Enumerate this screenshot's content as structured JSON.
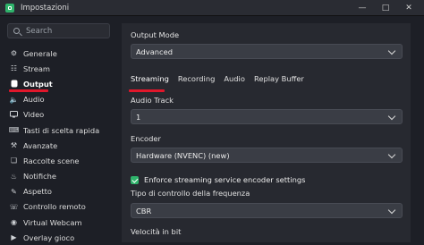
{
  "window": {
    "title": "Impostazioni"
  },
  "sidebar": {
    "search_placeholder": "Search",
    "items": [
      {
        "label": "Generale",
        "icon": "gear-icon"
      },
      {
        "label": "Stream",
        "icon": "globe-icon"
      },
      {
        "label": "Output",
        "icon": "output-icon",
        "active": true
      },
      {
        "label": "Audio",
        "icon": "speaker-icon"
      },
      {
        "label": "Video",
        "icon": "monitor-icon"
      },
      {
        "label": "Tasti di scelta rapida",
        "icon": "keyboard-icon"
      },
      {
        "label": "Avanzate",
        "icon": "wrench-icon"
      },
      {
        "label": "Raccolte scene",
        "icon": "collection-icon"
      },
      {
        "label": "Notifiche",
        "icon": "bell-icon"
      },
      {
        "label": "Aspetto",
        "icon": "brush-icon"
      },
      {
        "label": "Controllo remoto",
        "icon": "remote-icon"
      },
      {
        "label": "Virtual Webcam",
        "icon": "webcam-icon"
      },
      {
        "label": "Overlay gioco",
        "icon": "game-icon"
      }
    ]
  },
  "main": {
    "output_mode_label": "Output Mode",
    "output_mode_value": "Advanced",
    "tabs": [
      "Streaming",
      "Recording",
      "Audio",
      "Replay Buffer"
    ],
    "audio_track_label": "Audio Track",
    "audio_track_value": "1",
    "encoder_label": "Encoder",
    "encoder_value": "Hardware (NVENC) (new)",
    "enforce_label": "Enforce streaming service encoder settings",
    "enforce_checked": true,
    "rate_control_label": "Tipo di controllo della frequenza",
    "rate_control_value": "CBR",
    "bitrate_label": "Velocità in bit"
  },
  "colors": {
    "accent_red": "#e0172b",
    "check_green": "#2fb36b"
  }
}
